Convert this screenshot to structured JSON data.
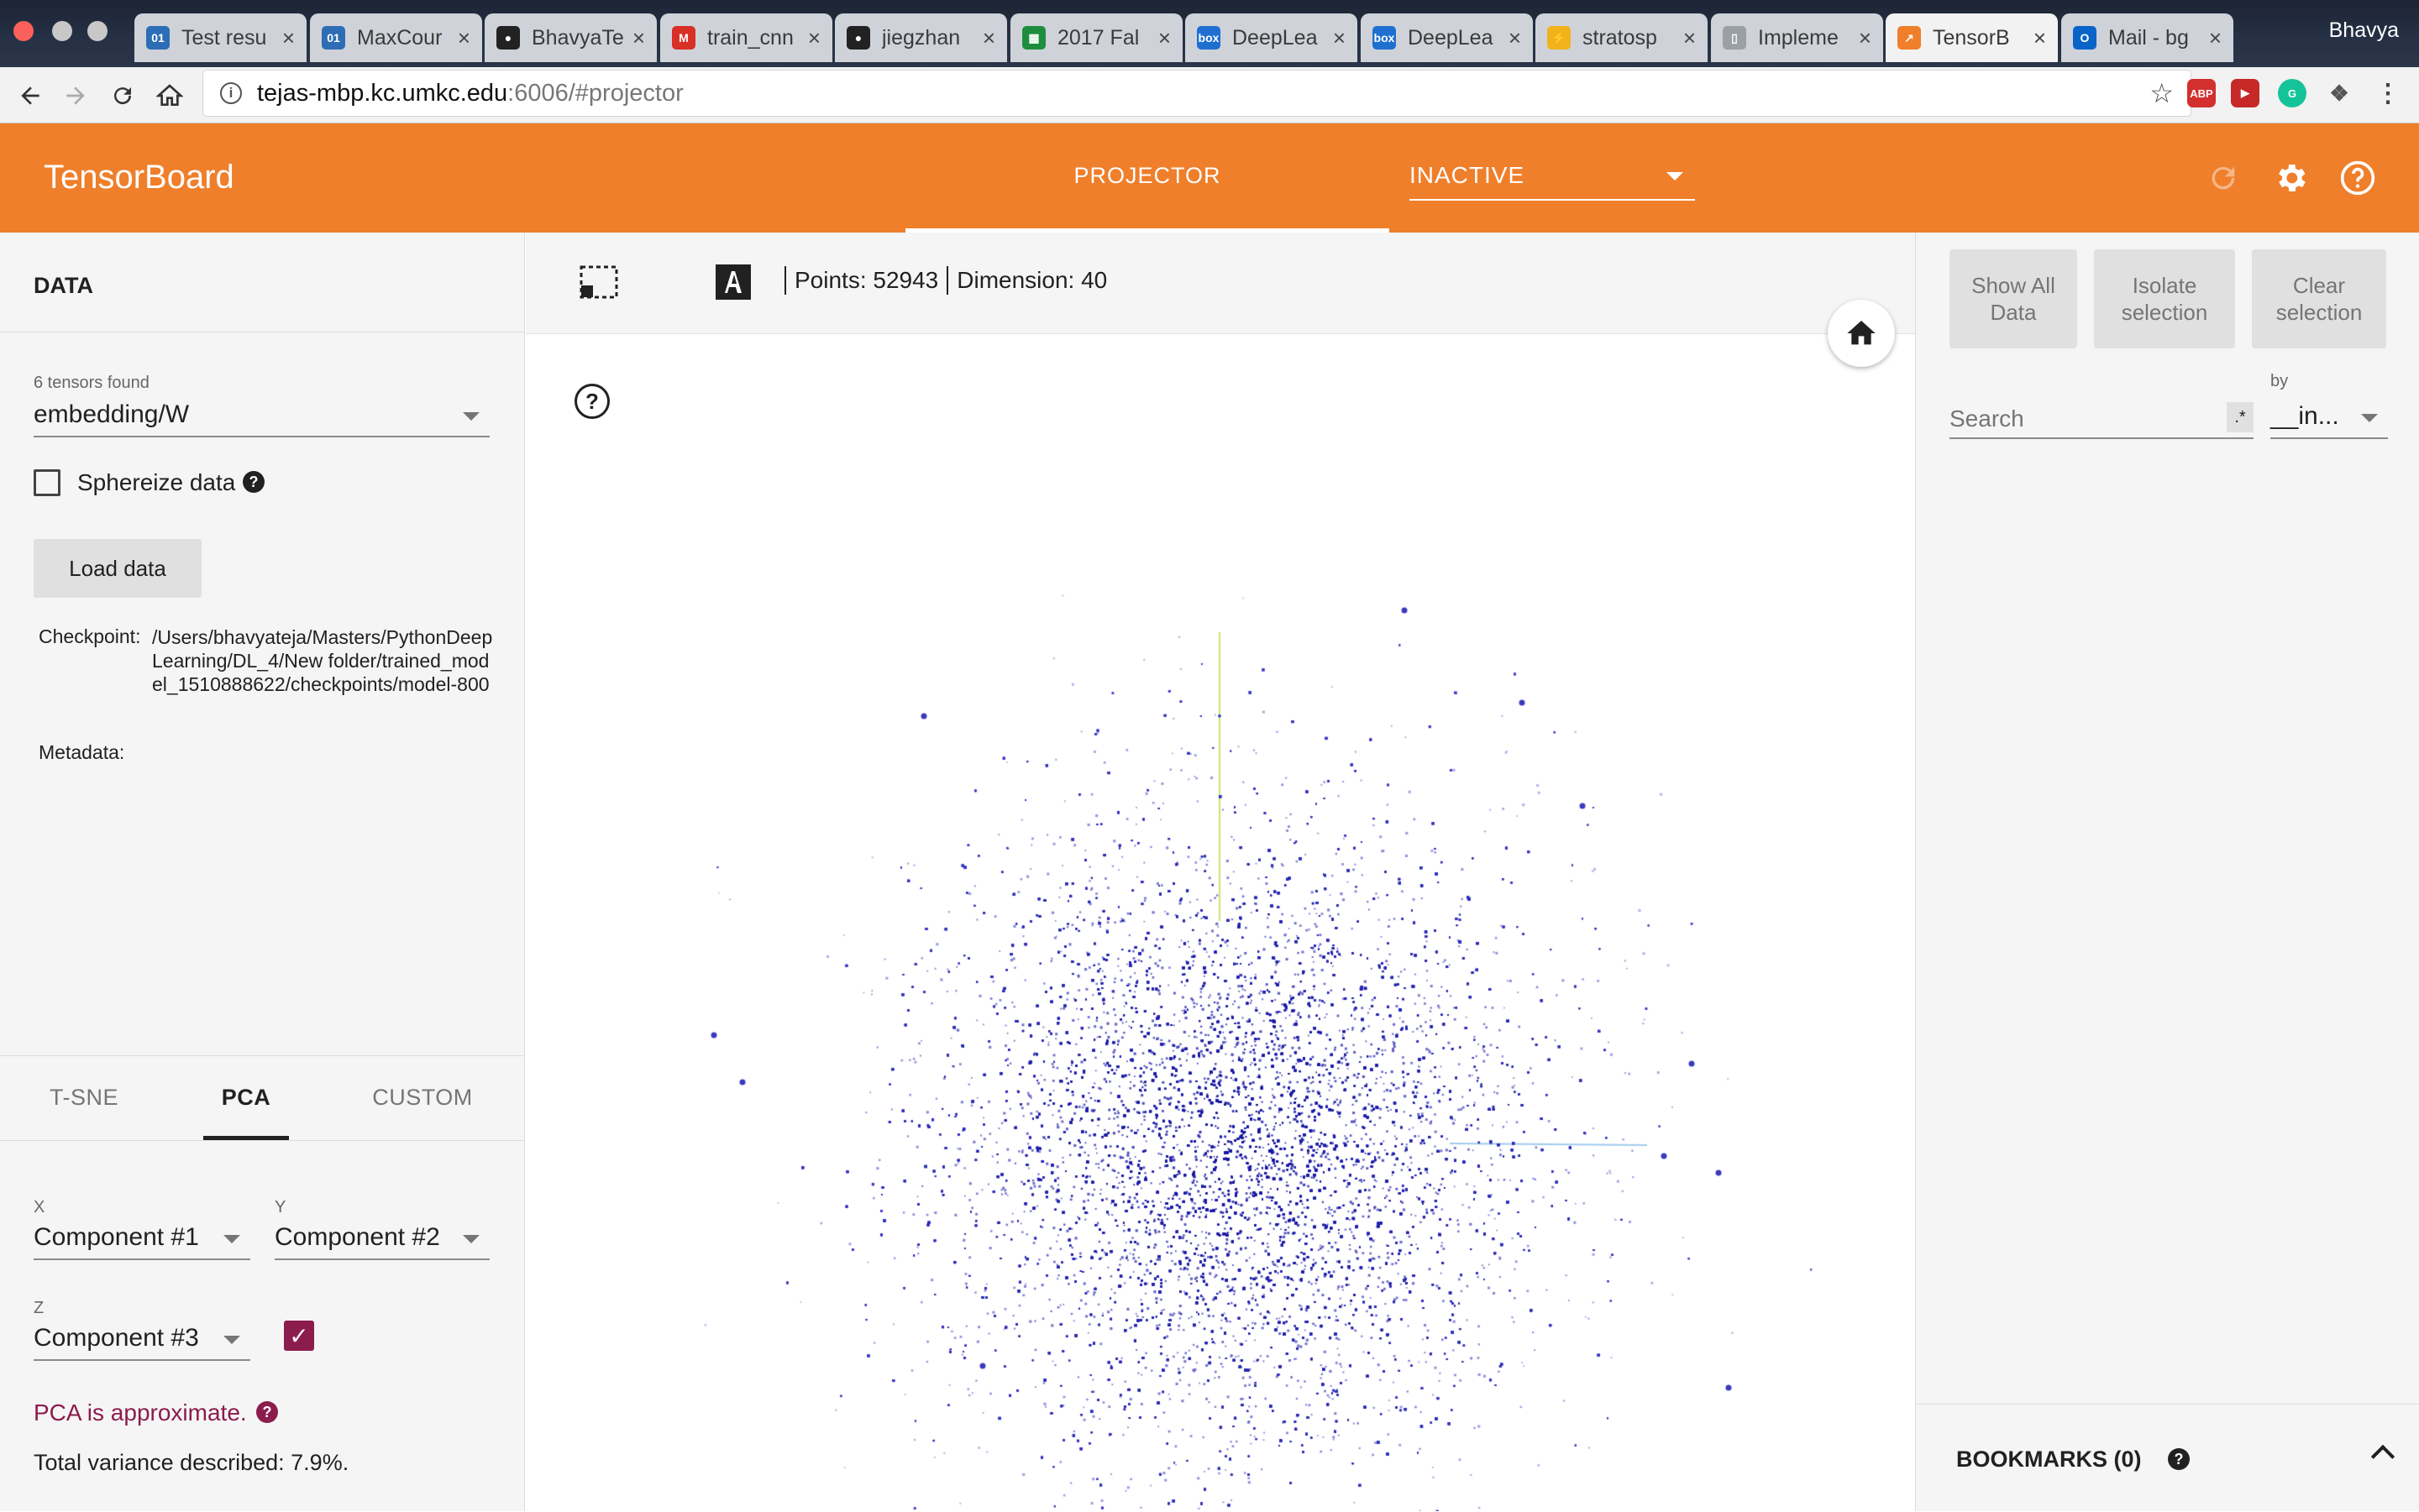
{
  "browser": {
    "tabs": [
      {
        "title": "Test resu",
        "icon": "01",
        "color": "#2d6db5"
      },
      {
        "title": "MaxCour",
        "icon": "01",
        "color": "#2d6db5"
      },
      {
        "title": "BhavyaTe",
        "icon": "github",
        "color": "#222222"
      },
      {
        "title": "train_cnn",
        "icon": "gmail",
        "color": "#d93025"
      },
      {
        "title": "jiegzhan",
        "icon": "github",
        "color": "#222222"
      },
      {
        "title": "2017 Fal",
        "icon": "sheets",
        "color": "#1e8e3e"
      },
      {
        "title": "DeepLea",
        "icon": "box",
        "color": "#1f6fd1"
      },
      {
        "title": "DeepLea",
        "icon": "box",
        "color": "#1f6fd1"
      },
      {
        "title": "stratosp",
        "icon": "bolt",
        "color": "#f2b21b"
      },
      {
        "title": "Impleme",
        "icon": "doc",
        "color": "#9aa0a6"
      },
      {
        "title": "TensorB",
        "icon": "tensorboard",
        "color": "#ef7f2b"
      },
      {
        "title": "Mail - bg",
        "icon": "outlook",
        "color": "#0a64c8"
      }
    ],
    "profile_name": "Bhavya",
    "url_host": "tejas-mbp.kc.umkc.edu",
    "url_rest": ":6006/#projector"
  },
  "header": {
    "title": "TensorBoard",
    "active_tab": "PROJECTOR",
    "run_select": "INACTIVE",
    "accent": "#ef7f2b"
  },
  "data_panel": {
    "title": "DATA",
    "tensors_found": "6 tensors found",
    "tensor": "embedding/W",
    "sphereize_label": "Sphereize data",
    "sphereize_checked": false,
    "load_button": "Load data",
    "checkpoint_label": "Checkpoint:",
    "checkpoint_value": "/Users/bhavyateja/Masters/PythonDeepLearning/DL_4/New folder/trained_model_1510888622/checkpoints/model-800",
    "metadata_label": "Metadata:"
  },
  "projection": {
    "tabs": [
      "T-SNE",
      "PCA",
      "CUSTOM"
    ],
    "active_tab": "PCA",
    "x_label": "X",
    "x_value": "Component #1",
    "y_label": "Y",
    "y_value": "Component #2",
    "z_label": "Z",
    "z_value": "Component #3",
    "z_enabled": true,
    "approx_text": "PCA is approximate.",
    "variance_text": "Total variance described: 7.9%.",
    "accent": "#8c1c4c"
  },
  "view": {
    "points_label": "Points: 52943",
    "dimension_label": "Dimension: 40",
    "point_color": "#1a1aa8"
  },
  "inspector": {
    "show_all": "Show All Data",
    "isolate": "Isolate selection",
    "clear": "Clear selection",
    "search_placeholder": "Search",
    "regex_label": ".*",
    "by_label": "by",
    "by_value": "__in...",
    "bookmarks_label": "BOOKMARKS (0)"
  }
}
